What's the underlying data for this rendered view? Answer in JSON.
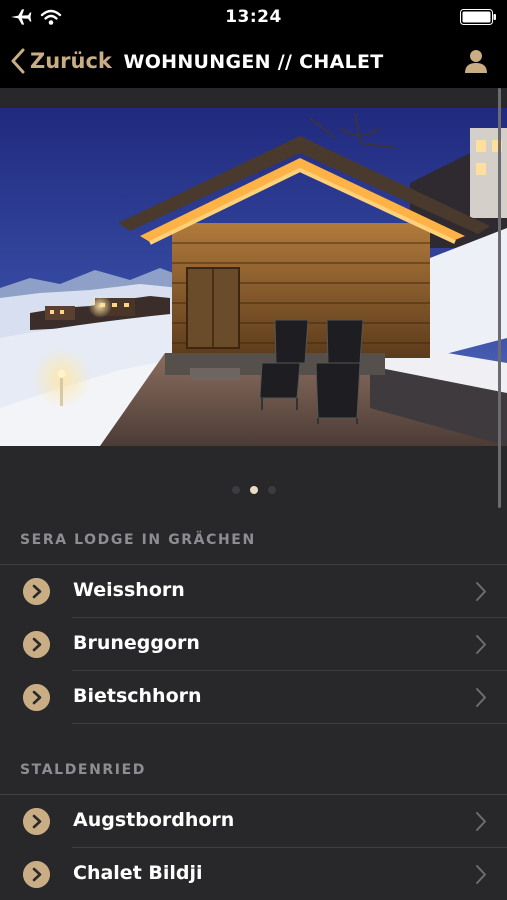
{
  "status_bar": {
    "time": "13:24",
    "icons": [
      "airplane-icon",
      "wifi-icon",
      "battery-icon"
    ]
  },
  "nav": {
    "back_label": "Zurück",
    "title": "WOHNUNGEN // CHALET",
    "user_icon": "user-icon"
  },
  "gallery": {
    "page_count": 3,
    "active_index": 1
  },
  "sections": [
    {
      "title": "SERA LODGE IN GRÄCHEN",
      "items": [
        {
          "label": "Weisshorn"
        },
        {
          "label": "Bruneggorn"
        },
        {
          "label": "Bietschhorn"
        }
      ]
    },
    {
      "title": "STALDENRIED",
      "items": [
        {
          "label": "Augstbordhorn"
        },
        {
          "label": "Chalet Bildji"
        }
      ]
    }
  ],
  "colors": {
    "accent": "#c9ad84",
    "background": "#28282b",
    "bar": "#000000",
    "divider": "#404044"
  }
}
